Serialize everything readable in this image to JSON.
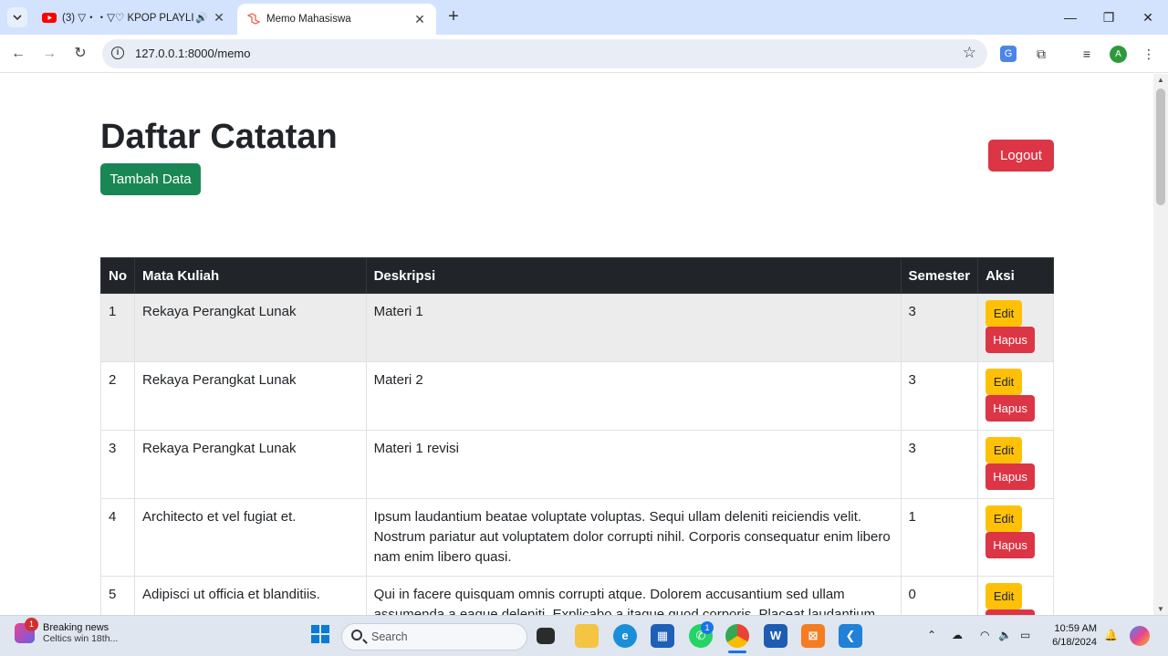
{
  "browser": {
    "tabs": [
      {
        "title": "(3) ▽・・▽♡ KPOP PLAYLI",
        "active": false
      },
      {
        "title": "Memo Mahasiswa",
        "active": true
      }
    ],
    "url": "127.0.0.1:8000/memo",
    "profile_initial": "A"
  },
  "page": {
    "heading": "Daftar Catatan",
    "add_button": "Tambah Data",
    "logout_button": "Logout",
    "table": {
      "headers": [
        "No",
        "Mata Kuliah",
        "Deskripsi",
        "Semester",
        "Aksi"
      ],
      "edit_label": "Edit",
      "delete_label": "Hapus",
      "rows": [
        {
          "no": "1",
          "mata_kuliah": "Rekaya Perangkat Lunak",
          "deskripsi": "Materi 1",
          "semester": "3"
        },
        {
          "no": "2",
          "mata_kuliah": "Rekaya Perangkat Lunak",
          "deskripsi": "Materi 2",
          "semester": "3"
        },
        {
          "no": "3",
          "mata_kuliah": "Rekaya Perangkat Lunak",
          "deskripsi": "Materi 1 revisi",
          "semester": "3"
        },
        {
          "no": "4",
          "mata_kuliah": "Architecto et vel fugiat et.",
          "deskripsi": "Ipsum laudantium beatae voluptate voluptas. Sequi ullam deleniti reiciendis velit. Nostrum pariatur aut voluptatem dolor corrupti nihil. Corporis consequatur enim libero nam enim libero quasi.",
          "semester": "1"
        },
        {
          "no": "5",
          "mata_kuliah": "Adipisci ut officia et blanditiis.",
          "deskripsi": "Qui in facere quisquam omnis corrupti atque. Dolorem accusantium sed ullam assumenda a eaque deleniti. Explicabo a itaque quod corporis. Placeat laudantium",
          "semester": "0"
        }
      ]
    }
  },
  "taskbar": {
    "news_title": "Breaking news",
    "news_sub": "Celtics win 18th...",
    "news_badge": "1",
    "search_label": "Search",
    "whatsapp_badge": "1",
    "time": "10:59 AM",
    "date": "6/18/2024"
  },
  "colors": {
    "success": "#198754",
    "danger": "#dc3545",
    "warning": "#ffc107",
    "table_header": "#212529"
  }
}
